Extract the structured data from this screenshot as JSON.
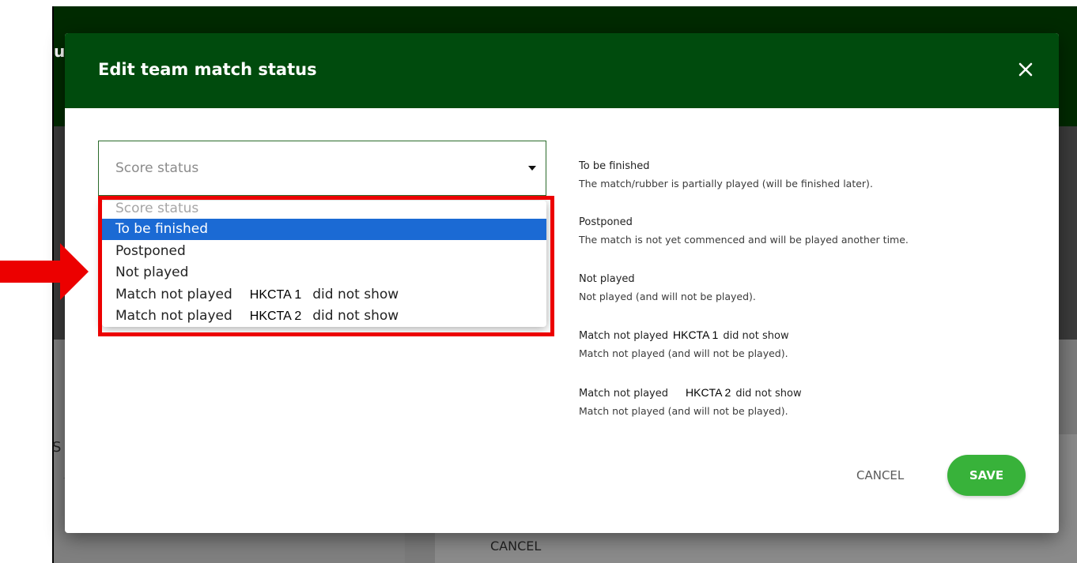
{
  "background": {
    "fragment_u": "u",
    "fragment_s": "S",
    "cancel_label": "CANCEL"
  },
  "modal": {
    "title": "Edit team match status",
    "close_icon": "close-icon",
    "select": {
      "placeholder": "Score status"
    },
    "dropdown": {
      "header": "Score status",
      "options": [
        {
          "label": "To be finished",
          "selected": true
        },
        {
          "label": "Postponed"
        },
        {
          "label": "Not played"
        },
        {
          "prefix": "Match not played",
          "team": "HKCTA 1",
          "suffix": "did not show"
        },
        {
          "prefix": "Match not played",
          "team": "HKCTA 2",
          "suffix": "did not show"
        }
      ]
    },
    "descriptions": [
      {
        "title": "To be finished",
        "text": "The match/rubber is partially played (will be finished later)."
      },
      {
        "title": "Postponed",
        "text": "The match is not yet commenced and will be played another time."
      },
      {
        "title": "Not played",
        "text": "Not played (and will not be played)."
      },
      {
        "prefix": "Match not played",
        "team": "HKCTA 1",
        "suffix": "did not show",
        "text": "Match not played (and will not be played)."
      },
      {
        "prefix": "Match not played",
        "team": "HKCTA 2",
        "suffix": "did not show",
        "text": "Match not played (and will not be played)."
      }
    ],
    "cancel_label": "CANCEL",
    "save_label": "SAVE"
  },
  "colors": {
    "header_green": "#004b0d",
    "save_green": "#38b23a",
    "selected_blue": "#1b6ad4",
    "annotation_red": "#ec0000"
  }
}
